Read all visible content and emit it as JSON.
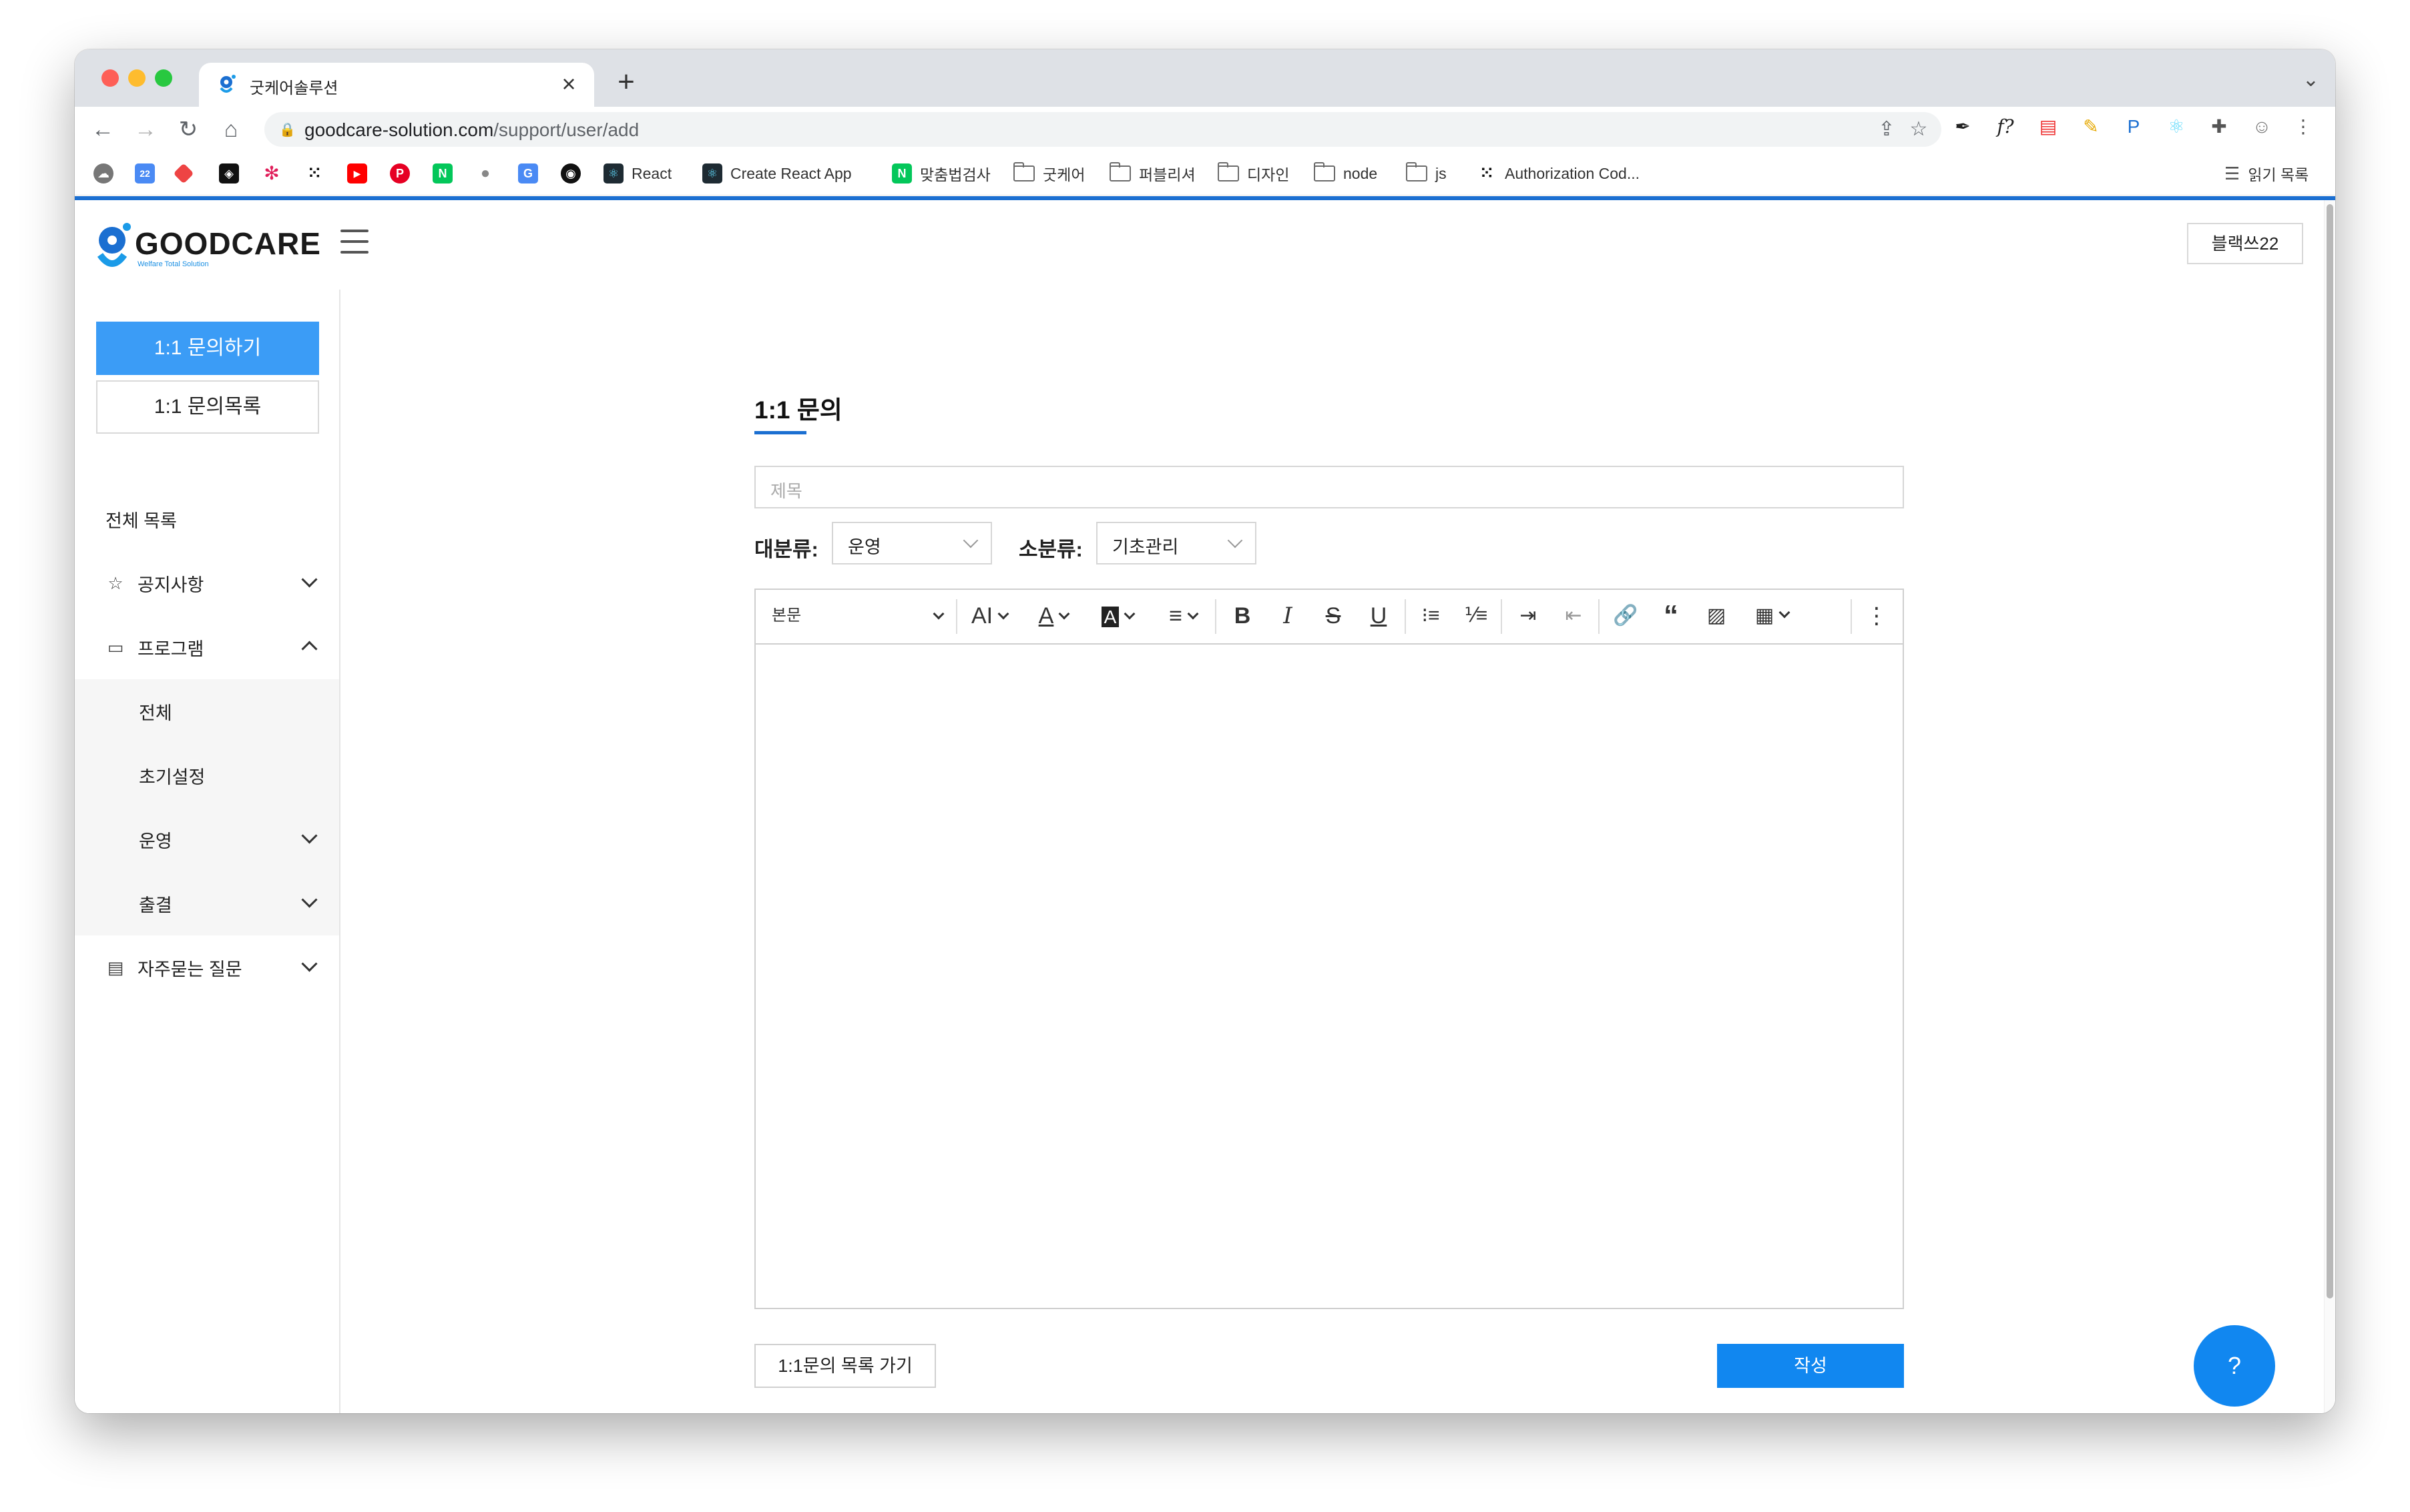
{
  "browser": {
    "tab_title": "굿케어솔루션",
    "url_host": "goodcare-solution.com",
    "url_path": "/support/user/add",
    "bookmarks": [
      {
        "icon": "calendar-icon",
        "label": "",
        "color": "#4a8af4"
      },
      {
        "icon": "react-icon",
        "label": "React",
        "color": "#1e2b33"
      },
      {
        "icon": "react-icon",
        "label": "Create React App",
        "color": "#1e2b33"
      },
      {
        "icon": "naver-icon",
        "label": "맞춤법검사",
        "color": "#03c75a"
      },
      {
        "icon": "folder-icon",
        "label": "굿케어"
      },
      {
        "icon": "folder-icon",
        "label": "퍼블리셔"
      },
      {
        "icon": "folder-icon",
        "label": "디자인"
      },
      {
        "icon": "folder-icon",
        "label": "node"
      },
      {
        "icon": "folder-icon",
        "label": "js"
      },
      {
        "icon": "dots-icon",
        "label": "Authorization Cod..."
      }
    ],
    "reading_list": "읽기 목록"
  },
  "header": {
    "logo_text": "GOODCARE",
    "logo_sub": "Welfare Total Solution",
    "user_button": "블랙쓰22"
  },
  "sidebar": {
    "primary_button": "1:1 문의하기",
    "secondary_button": "1:1 문의목록",
    "items": [
      {
        "label": "전체 목록"
      },
      {
        "label": "공지사항"
      },
      {
        "label": "프로그램"
      },
      {
        "label": "전체"
      },
      {
        "label": "초기설정"
      },
      {
        "label": "운영"
      },
      {
        "label": "출결"
      },
      {
        "label": "자주묻는 질문"
      }
    ]
  },
  "main": {
    "title": "1:1 문의",
    "subject_placeholder": "제목",
    "major_label": "대분류:",
    "major_value": "운영",
    "minor_label": "소분류:",
    "minor_value": "기초관리",
    "editor_style": "본문",
    "back_button": "1:1문의 목록 가기",
    "submit_button": "작성",
    "help_button": "?"
  },
  "colors": {
    "accent": "#1187f0",
    "sidebar_primary": "#3b9cf6",
    "top_border": "#1b6fd1"
  }
}
